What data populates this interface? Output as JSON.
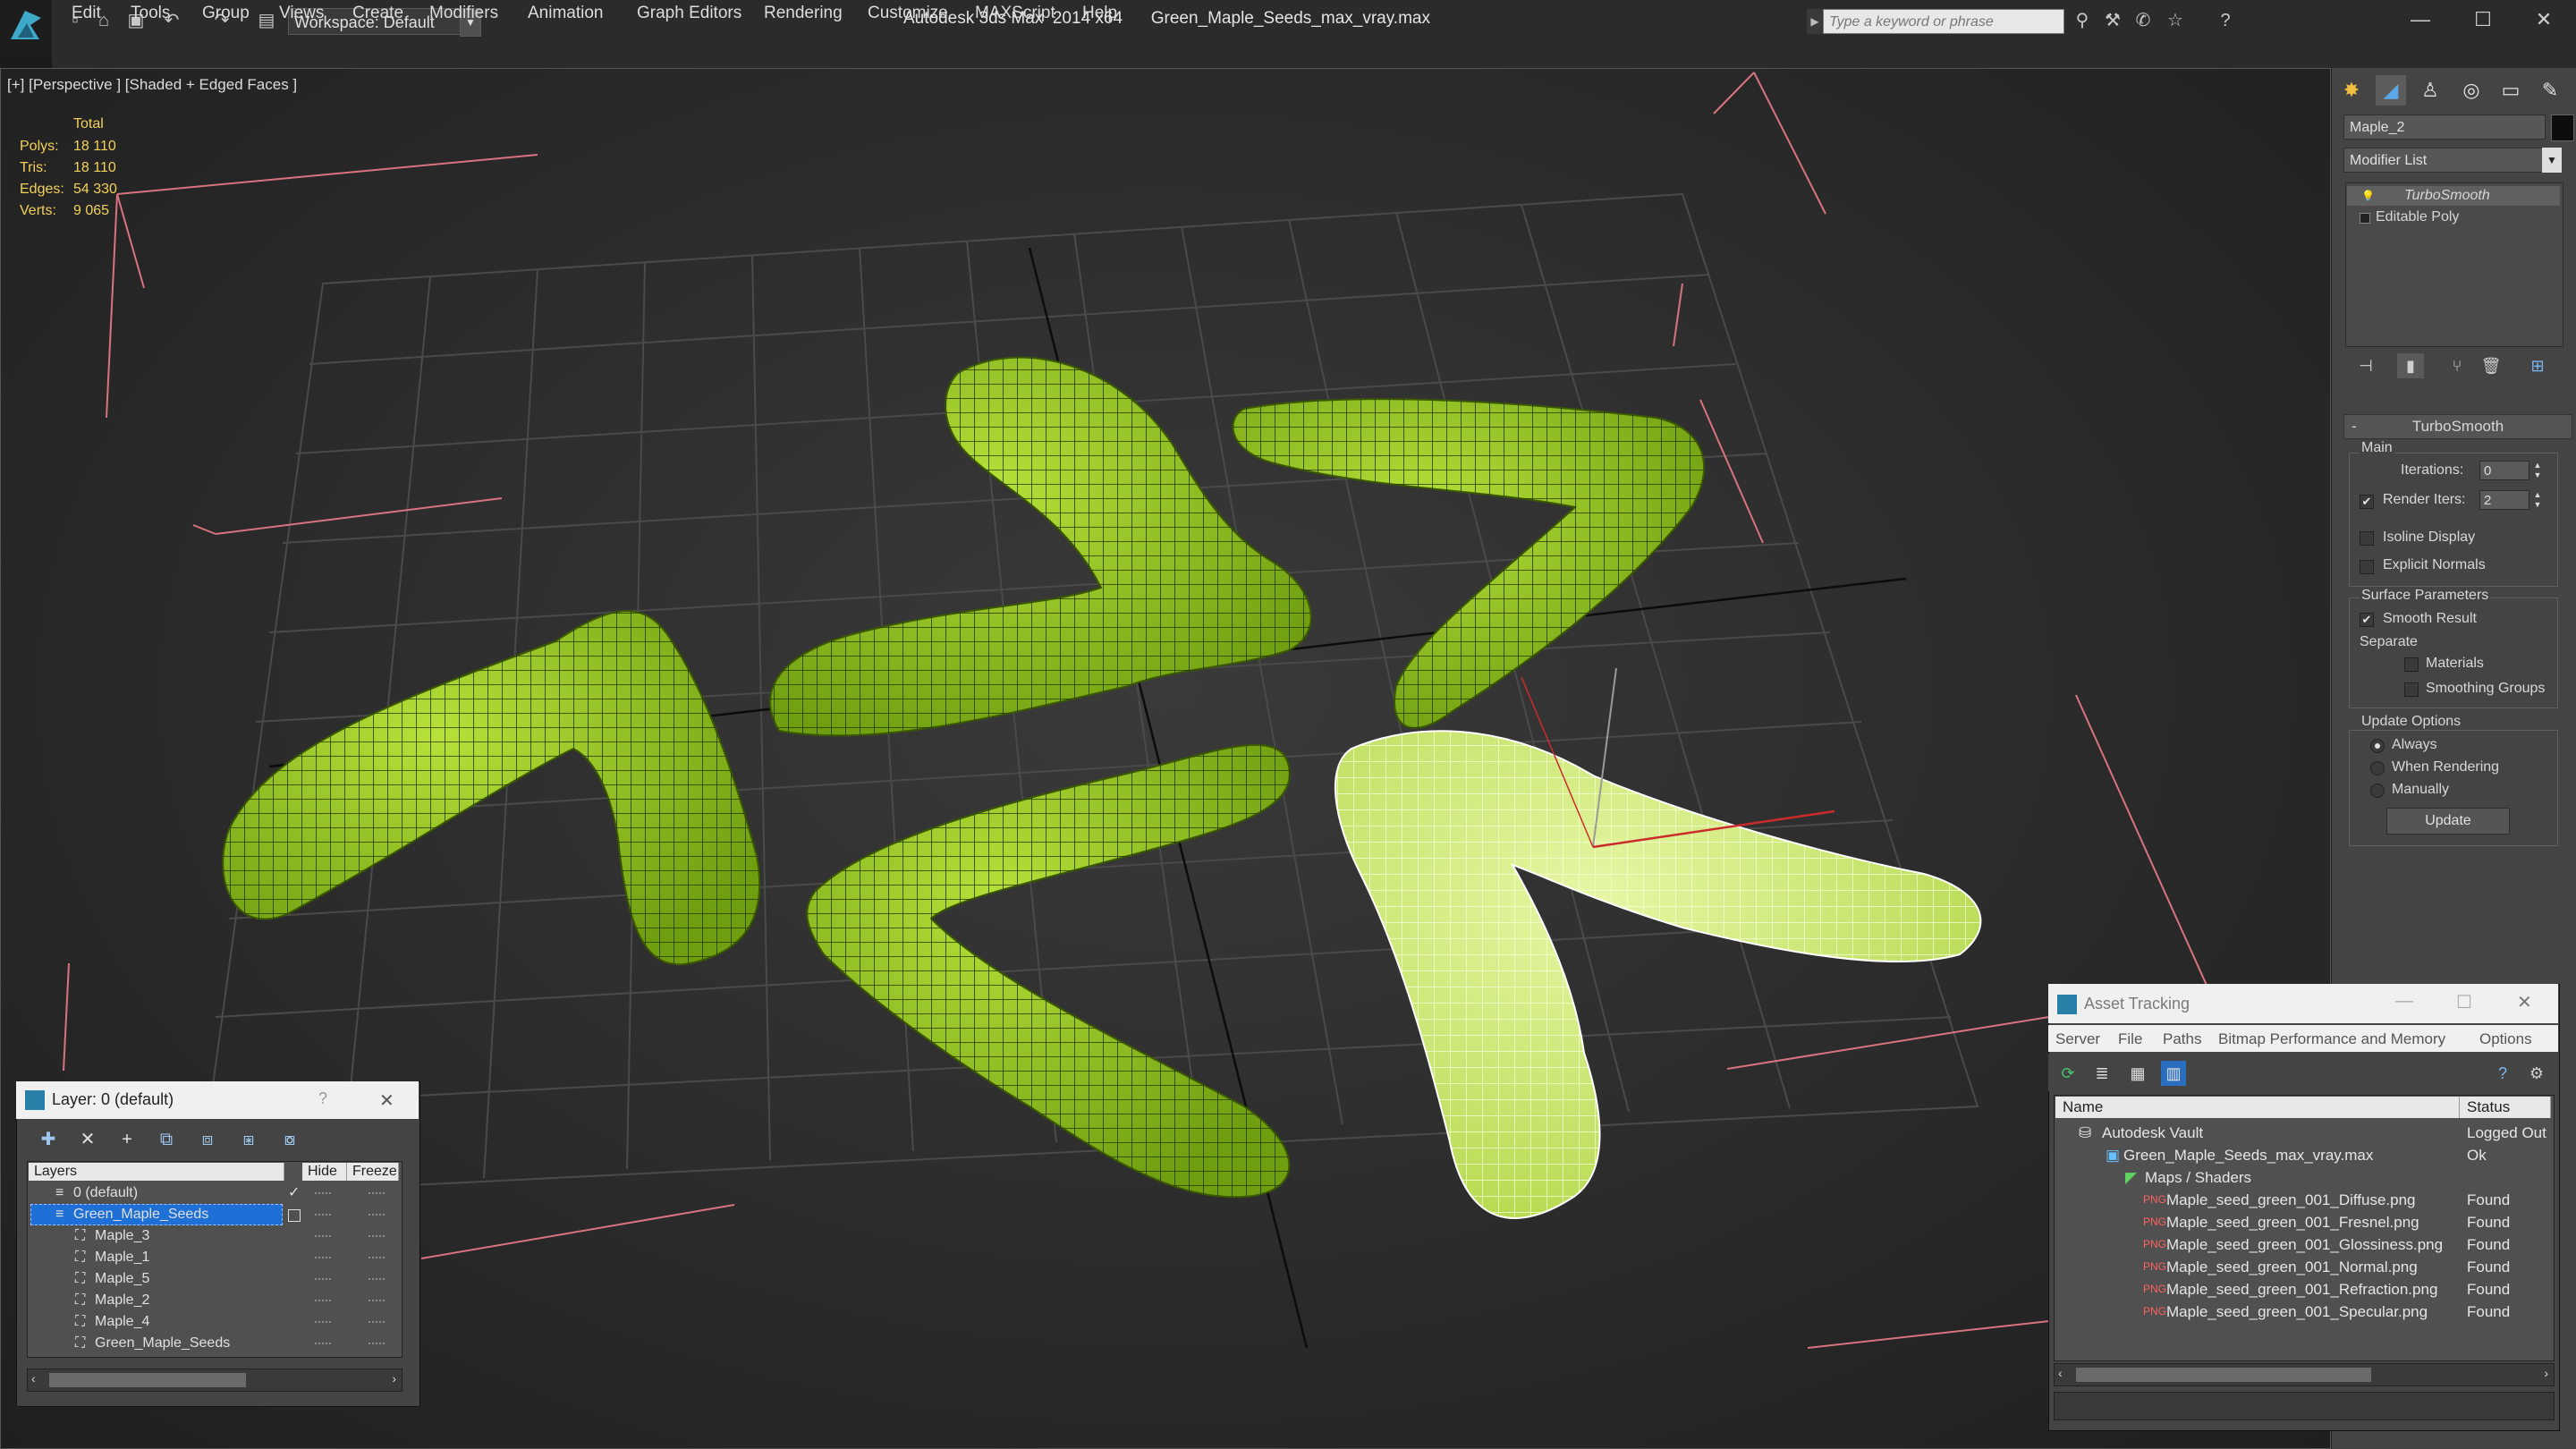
{
  "title_bar": {
    "workspace": "Workspace: Default",
    "app": "Autodesk 3ds Max  2014 x64",
    "file": "Green_Maple_Seeds_max_vray.max",
    "search_placeholder": "Type a keyword or phrase",
    "minimize": "—",
    "maximize": "☐",
    "close": "✕"
  },
  "menu": [
    "Edit",
    "Tools",
    "Group",
    "Views",
    "Create",
    "Modifiers",
    "Animation",
    "Graph Editors",
    "Rendering",
    "Customize",
    "MAXScript",
    "Help"
  ],
  "viewport": {
    "label": "[+] [Perspective ] [Shaded + Edged Faces ]",
    "stats": {
      "header": "Total",
      "rows": [
        {
          "label": "Polys:",
          "value": "18 110"
        },
        {
          "label": "Tris:",
          "value": "18 110"
        },
        {
          "label": "Edges:",
          "value": "54 330"
        },
        {
          "label": "Verts:",
          "value": "9 065"
        }
      ]
    }
  },
  "command_panel": {
    "object_name": "Maple_2",
    "modifier_list": "Modifier List",
    "stack": [
      "TurboSmooth",
      "Editable Poly"
    ],
    "rollout": "TurboSmooth",
    "main": {
      "group": "Main",
      "iterations_label": "Iterations:",
      "iterations": "0",
      "render_iters_label": "Render Iters:",
      "render_iters": "2",
      "isoline": "Isoline Display",
      "explicit_normals": "Explicit Normals"
    },
    "surface": {
      "group": "Surface Parameters",
      "smooth_result": "Smooth Result",
      "separate": "Separate",
      "materials": "Materials",
      "smoothing_groups": "Smoothing Groups"
    },
    "update_options": {
      "group": "Update Options",
      "always": "Always",
      "when_rendering": "When Rendering",
      "manually": "Manually",
      "update_button": "Update"
    }
  },
  "layer_dialog": {
    "title": "Layer: 0 (default)",
    "help": "?",
    "close": "✕",
    "columns": [
      "Layers",
      "Hide",
      "Freeze"
    ],
    "rows": [
      {
        "name": "0 (default)",
        "check": "✓"
      },
      {
        "name": "Green_Maple_Seeds",
        "check": ""
      },
      {
        "name": "Maple_3",
        "check": ""
      },
      {
        "name": "Maple_1",
        "check": ""
      },
      {
        "name": "Maple_5",
        "check": ""
      },
      {
        "name": "Maple_2",
        "check": ""
      },
      {
        "name": "Maple_4",
        "check": ""
      },
      {
        "name": "Green_Maple_Seeds",
        "check": ""
      }
    ]
  },
  "asset_dialog": {
    "title": "Asset Tracking",
    "menu": [
      "Server",
      "File",
      "Paths",
      "Bitmap Performance and Memory",
      "Options"
    ],
    "columns": [
      "Name",
      "Status"
    ],
    "rows": [
      {
        "name": "Autodesk Vault",
        "status": "Logged Out"
      },
      {
        "name": "Green_Maple_Seeds_max_vray.max",
        "status": "Ok"
      },
      {
        "name": "Maps / Shaders",
        "status": ""
      },
      {
        "name": "Maple_seed_green_001_Diffuse.png",
        "status": "Found"
      },
      {
        "name": "Maple_seed_green_001_Fresnel.png",
        "status": "Found"
      },
      {
        "name": "Maple_seed_green_001_Glossiness.png",
        "status": "Found"
      },
      {
        "name": "Maple_seed_green_001_Normal.png",
        "status": "Found"
      },
      {
        "name": "Maple_seed_green_001_Refraction.png",
        "status": "Found"
      },
      {
        "name": "Maple_seed_green_001_Specular.png",
        "status": "Found"
      }
    ]
  },
  "colors": {
    "accent_selected": "#1e6fd6",
    "stats_yellow": "#f2d15a",
    "leaf_green": "#8bc11a"
  }
}
